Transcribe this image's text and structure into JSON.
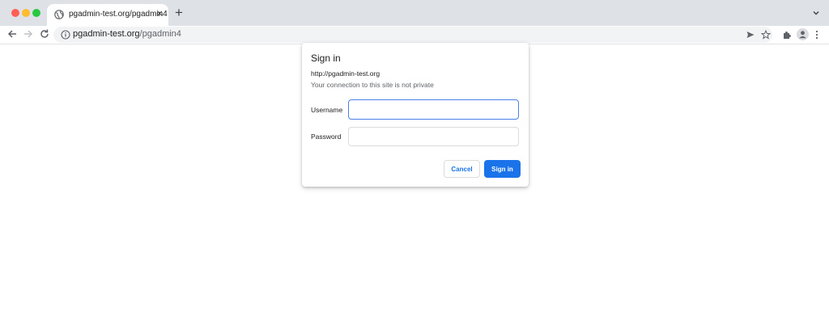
{
  "tab": {
    "title": "pgadmin-test.org/pgadmin4",
    "close_glyph": "×",
    "icon": "globe-icon"
  },
  "new_tab_glyph": "+",
  "address_bar": {
    "host": "pgadmin-test.org",
    "path": "/pgadmin4",
    "icon": "info-icon"
  },
  "dialog": {
    "title": "Sign in",
    "host": "http://pgadmin-test.org",
    "warning": "Your connection to this site is not private",
    "username_label": "Username",
    "username_value": "",
    "password_label": "Password",
    "password_value": "",
    "cancel_label": "Cancel",
    "signin_label": "Sign in"
  },
  "colors": {
    "accent": "#1a73e8",
    "focus_border": "#4a80e8",
    "tabstrip": "#dee1e6"
  }
}
